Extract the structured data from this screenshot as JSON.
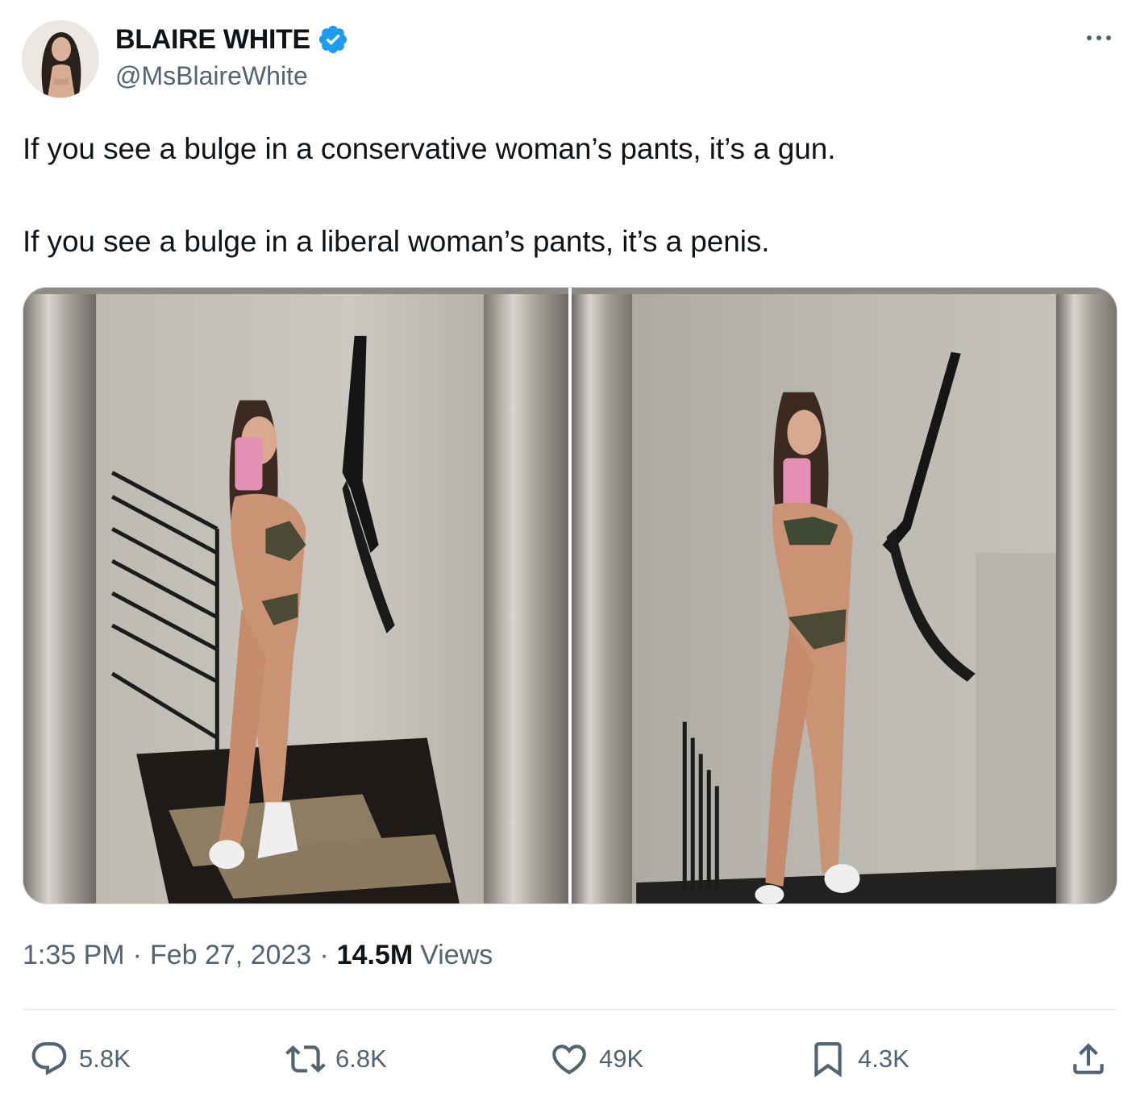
{
  "author": {
    "display_name": "BLAIRE WHITE",
    "handle": "@MsBlaireWhite",
    "verified": true,
    "verified_color": "#1d9bf0"
  },
  "tweet": {
    "lines": [
      "If you see a bulge in a conservative woman’s pants, it’s a gun.",
      "If you see a bulge in a liberal woman’s pants, it’s a penis."
    ]
  },
  "media": {
    "count": 2
  },
  "meta": {
    "time": "1:35 PM",
    "separator": "·",
    "date": "Feb 27, 2023",
    "views_count": "14.5M",
    "views_label": "Views"
  },
  "actions": {
    "replies": "5.8K",
    "retweets": "6.8K",
    "likes": "49K",
    "bookmarks": "4.3K"
  },
  "icons": {
    "more": "more-horizontal-icon",
    "verified": "verified-badge-icon",
    "reply": "reply-icon",
    "retweet": "retweet-icon",
    "like": "heart-icon",
    "bookmark": "bookmark-icon",
    "share": "share-icon"
  },
  "colors": {
    "text_primary": "#0f1419",
    "text_secondary": "#536471",
    "accent": "#1d9bf0",
    "border": "#cfd9de"
  }
}
